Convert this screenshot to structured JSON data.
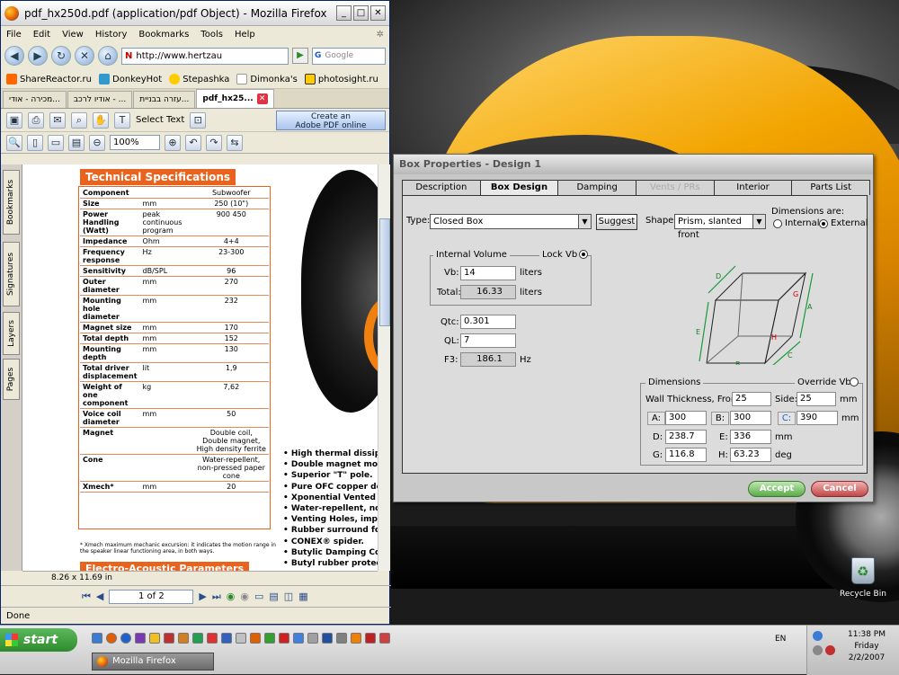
{
  "firefox": {
    "title": "pdf_hx250d.pdf (application/pdf Object) - Mozilla Firefox",
    "menu": [
      "File",
      "Edit",
      "View",
      "History",
      "Bookmarks",
      "Tools",
      "Help"
    ],
    "url": "http://www.hertzau",
    "search_placeholder": "Google",
    "bookmarks": [
      "ShareReactor.ru",
      "DonkeyHot",
      "Stepashka",
      "Dimonka's",
      "photosight.ru"
    ],
    "tabs": [
      "מכירה - אודי...",
      "אודיו לרכב - ...",
      "עזרה בבניית...",
      "pdf_hx25..."
    ],
    "select_text": "Select Text",
    "adobe_line1": "Create an",
    "adobe_line2": "Adobe PDF online",
    "zoom": "100%",
    "side_tabs": [
      "Bookmarks",
      "Signatures",
      "Layers",
      "Pages"
    ],
    "page_size": "8.26 x 11.69 in",
    "page_indicator": "1 of 2",
    "status": "Done"
  },
  "pdf": {
    "spec_title": "Technical Specifications",
    "spec_rows": [
      {
        "k": "Component",
        "u": "",
        "v": "Subwoofer"
      },
      {
        "k": "Size",
        "u": "mm",
        "v": "250 (10\")"
      },
      {
        "k": "Power Handling (Watt)",
        "u": "peak continuous program",
        "v": "900 450"
      },
      {
        "k": "Impedance",
        "u": "Ohm",
        "v": "4+4"
      },
      {
        "k": "Frequency response",
        "u": "Hz",
        "v": "23-300"
      },
      {
        "k": "Sensitivity",
        "u": "dB/SPL",
        "v": "96"
      },
      {
        "k": "Outer diameter",
        "u": "mm",
        "v": "270"
      },
      {
        "k": "Mounting hole diameter",
        "u": "mm",
        "v": "232"
      },
      {
        "k": "Magnet size",
        "u": "mm",
        "v": "170"
      },
      {
        "k": "Total depth",
        "u": "mm",
        "v": "152"
      },
      {
        "k": "Mounting depth",
        "u": "mm",
        "v": "130"
      },
      {
        "k": "Total driver displacement",
        "u": "lit",
        "v": "1,9"
      },
      {
        "k": "Weight of one component",
        "u": "kg",
        "v": "7,62"
      },
      {
        "k": "Voice coil diameter",
        "u": "mm",
        "v": "50"
      },
      {
        "k": "Magnet",
        "u": "",
        "v": "Double coil, Double magnet, High density ferrite"
      },
      {
        "k": "Cone",
        "u": "",
        "v": "Water-repellent, non-pressed paper cone"
      },
      {
        "k": "Xmech*",
        "u": "mm",
        "v": "20"
      }
    ],
    "footnote": "* Xmech maximum mechanic excursion: it indicates the motion range in the speaker linear functioning area, in both ways.",
    "next_section": "Electro-Acoustic Parameters",
    "features": [
      "• High thermal dissipat",
      "• Double magnet moto",
      "• Superior \"T\" pole.",
      "• Pure OFC copper do",
      "• Xponential Vented Ho",
      "• Water-repellent, non-",
      "• Venting Holes, impro",
      "• Rubber surround for",
      "• CONEX® spider.",
      "• Butylic Damping Cov",
      "• Butyl rubber protecti"
    ]
  },
  "dialog": {
    "title": "Box Properties - Design 1",
    "tabs": [
      "Description",
      "Box Design",
      "Damping",
      "Vents / PRs",
      "Interior",
      "Parts List"
    ],
    "type_label": "Type:",
    "type_value": "Closed Box",
    "suggest": "Suggest",
    "shape_label": "Shape:",
    "shape_value": "Prism, slanted front",
    "dims_are": "Dimensions are:",
    "internal": "Internal",
    "external": "External",
    "internal_volume": "Internal Volume",
    "lock_vb": "Lock Vb",
    "vb_label": "Vb:",
    "vb_value": "14",
    "total_label": "Total:",
    "total_value": "16.33",
    "liters": "liters",
    "qtc_label": "Qtc:",
    "qtc_value": "0.301",
    "ql_label": "QL:",
    "ql_value": "7",
    "f3_label": "F3:",
    "f3_value": "186.1",
    "hz": "Hz",
    "dimensions": "Dimensions",
    "override_vb": "Override Vb",
    "wall_front_label": "Wall Thickness, Front:",
    "wall_front": "25",
    "side_label": "Side:",
    "side": "25",
    "mm": "mm",
    "deg": "deg",
    "dims": {
      "A": "300",
      "B": "300",
      "C": "390",
      "D": "238.7",
      "E": "336",
      "G": "116.8",
      "H": "63.23"
    },
    "diagram_letters": [
      "D",
      "A",
      "G",
      "E",
      "H",
      "B",
      "C"
    ],
    "accept": "Accept",
    "cancel": "Cancel"
  },
  "desktop": {
    "recycle": "Recycle Bin"
  },
  "taskbar": {
    "start": "start",
    "task": "Mozilla Firefox",
    "lang": "EN",
    "time": "11:38 PM",
    "day": "Friday",
    "date": "2/2/2007"
  }
}
